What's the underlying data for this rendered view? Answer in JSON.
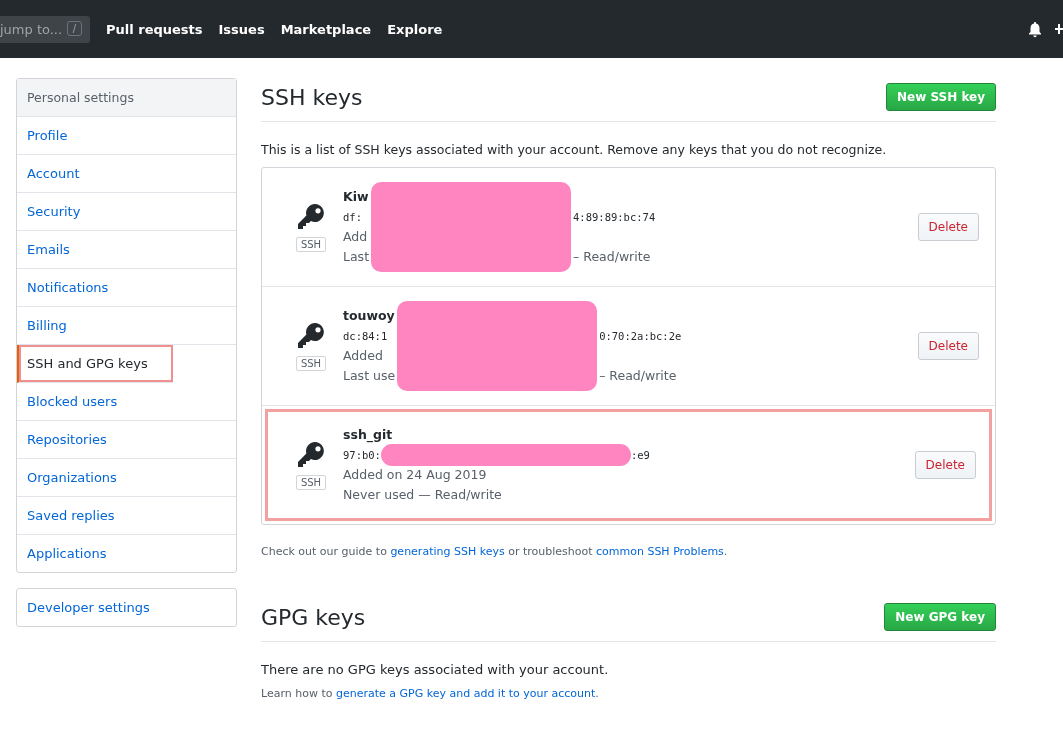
{
  "header": {
    "search": {
      "placeholder": "jump to...",
      "shortcut": "/"
    },
    "nav": [
      "Pull requests",
      "Issues",
      "Marketplace",
      "Explore"
    ]
  },
  "sidebar": {
    "title": "Personal settings",
    "items": [
      {
        "label": "Profile",
        "selected": false,
        "highlighted": false
      },
      {
        "label": "Account",
        "selected": false,
        "highlighted": false
      },
      {
        "label": "Security",
        "selected": false,
        "highlighted": false
      },
      {
        "label": "Emails",
        "selected": false,
        "highlighted": false
      },
      {
        "label": "Notifications",
        "selected": false,
        "highlighted": false
      },
      {
        "label": "Billing",
        "selected": false,
        "highlighted": false
      },
      {
        "label": "SSH and GPG keys",
        "selected": true,
        "highlighted": true
      },
      {
        "label": "Blocked users",
        "selected": false,
        "highlighted": false
      },
      {
        "label": "Repositories",
        "selected": false,
        "highlighted": false
      },
      {
        "label": "Organizations",
        "selected": false,
        "highlighted": false
      },
      {
        "label": "Saved replies",
        "selected": false,
        "highlighted": false
      },
      {
        "label": "Applications",
        "selected": false,
        "highlighted": false
      }
    ],
    "developer": "Developer settings"
  },
  "ssh": {
    "title": "SSH keys",
    "button": "New SSH key",
    "intro": "This is a list of SSH keys associated with your account. Remove any keys that you do not recognize.",
    "keys": [
      {
        "badge": "SSH",
        "kind": "block",
        "highlighted": false,
        "title": "Kiw",
        "fingerprint": "df:",
        "fingerprint_end": "4:89:89:bc:74",
        "added": "Add",
        "usage": "Last",
        "usage_end": "– Read/write",
        "delete": "Delete"
      },
      {
        "badge": "SSH",
        "kind": "block",
        "highlighted": false,
        "title": "touwoy",
        "fingerprint": "dc:84:1",
        "fingerprint_end": "0:70:2a:bc:2e",
        "added": "Added",
        "usage": "Last use",
        "usage_end": "– Read/write",
        "delete": "Delete"
      },
      {
        "badge": "SSH",
        "kind": "inline",
        "highlighted": true,
        "title": "ssh_git",
        "fingerprint": "97:b0:",
        "fingerprint_end": ":e9",
        "added": "Added on 24 Aug 2019",
        "usage": "Never used — Read/write",
        "delete": "Delete"
      }
    ],
    "guide": {
      "before": "Check out our guide to ",
      "link1": "generating SSH keys",
      "middle": " or troubleshoot ",
      "link2": "common SSH Problems",
      "after": "."
    }
  },
  "gpg": {
    "title": "GPG keys",
    "button": "New GPG key",
    "empty": "There are no GPG keys associated with your account.",
    "learn": {
      "before": "Learn how to ",
      "link": "generate a GPG key and add it to your account",
      "after": "."
    }
  }
}
